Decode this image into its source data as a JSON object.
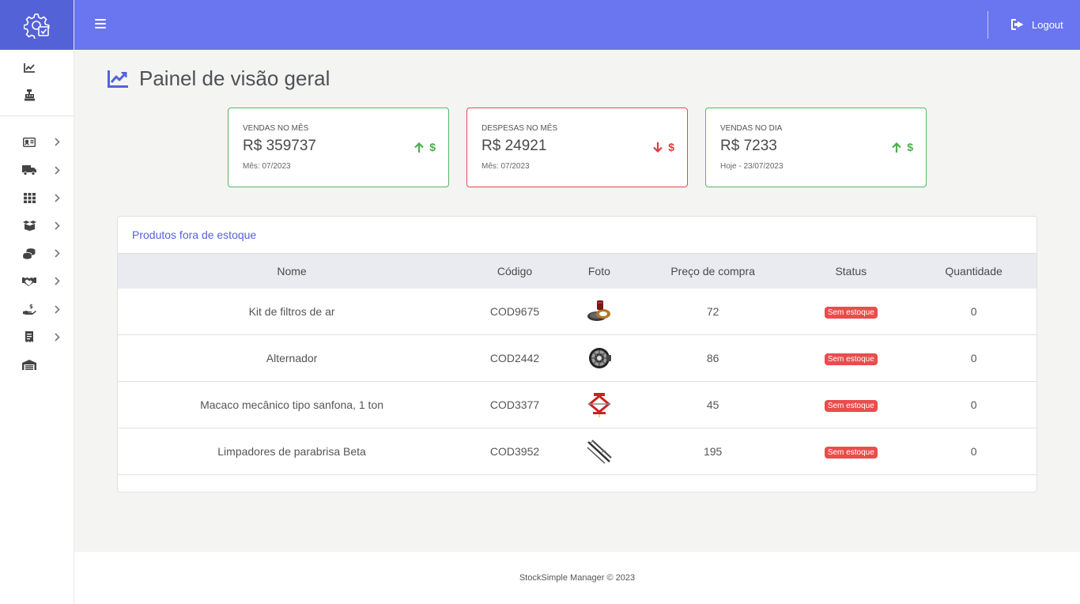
{
  "app": {
    "logo_icon": "gear-check-icon",
    "brand_color": "#5462d8",
    "topbar_color": "#6976ef"
  },
  "sidebar": {
    "top_items": [
      {
        "icon": "chart-line-icon"
      },
      {
        "icon": "cash-register-icon"
      }
    ],
    "items": [
      {
        "icon": "id-card-icon",
        "has_submenu": true
      },
      {
        "icon": "truck-icon",
        "has_submenu": true
      },
      {
        "icon": "grid-icon",
        "has_submenu": true
      },
      {
        "icon": "boxes-icon",
        "has_submenu": true
      },
      {
        "icon": "coins-icon",
        "has_submenu": true
      },
      {
        "icon": "handshake-icon",
        "has_submenu": true
      },
      {
        "icon": "hand-money-icon",
        "has_submenu": true
      },
      {
        "icon": "receipt-icon",
        "has_submenu": true
      },
      {
        "icon": "warehouse-icon",
        "has_submenu": false
      }
    ]
  },
  "topbar": {
    "logout_label": "Logout"
  },
  "page": {
    "title": "Painel de visão geral"
  },
  "cards": [
    {
      "label": "VENDAS NO MÊS",
      "value": "R$ 359737",
      "sub": "Mês: 07/2023",
      "trend": "up",
      "symbol": "$",
      "color": "#4caf50"
    },
    {
      "label": "DESPESAS NO MÊS",
      "value": "R$ 24921",
      "sub": "Mês: 07/2023",
      "trend": "down",
      "symbol": "$",
      "color": "#e03b3b"
    },
    {
      "label": "VENDAS NO DIA",
      "value": "R$ 7233",
      "sub": "Hoje - 23/07/2023",
      "trend": "up",
      "symbol": "$",
      "color": "#4caf50"
    }
  ],
  "out_of_stock": {
    "title": "Produtos fora de estoque",
    "columns": [
      "Nome",
      "Código",
      "Foto",
      "Preço de compra",
      "Status",
      "Quantidade"
    ],
    "rows": [
      {
        "name": "Kit de filtros de ar",
        "code": "COD9675",
        "photo": "air-filter-kit-photo",
        "price": "72",
        "status": "Sem estoque",
        "qty": "0"
      },
      {
        "name": "Alternador",
        "code": "COD2442",
        "photo": "alternator-photo",
        "price": "86",
        "status": "Sem estoque",
        "qty": "0"
      },
      {
        "name": "Macaco mecânico tipo sanfona, 1 ton",
        "code": "COD3377",
        "photo": "scissor-jack-photo",
        "price": "45",
        "status": "Sem estoque",
        "qty": "0"
      },
      {
        "name": "Limpadores de parabrisa Beta",
        "code": "COD3952",
        "photo": "wiper-blades-photo",
        "price": "195",
        "status": "Sem estoque",
        "qty": "0"
      }
    ]
  },
  "footer": {
    "text": "StockSimple Manager © 2023"
  }
}
